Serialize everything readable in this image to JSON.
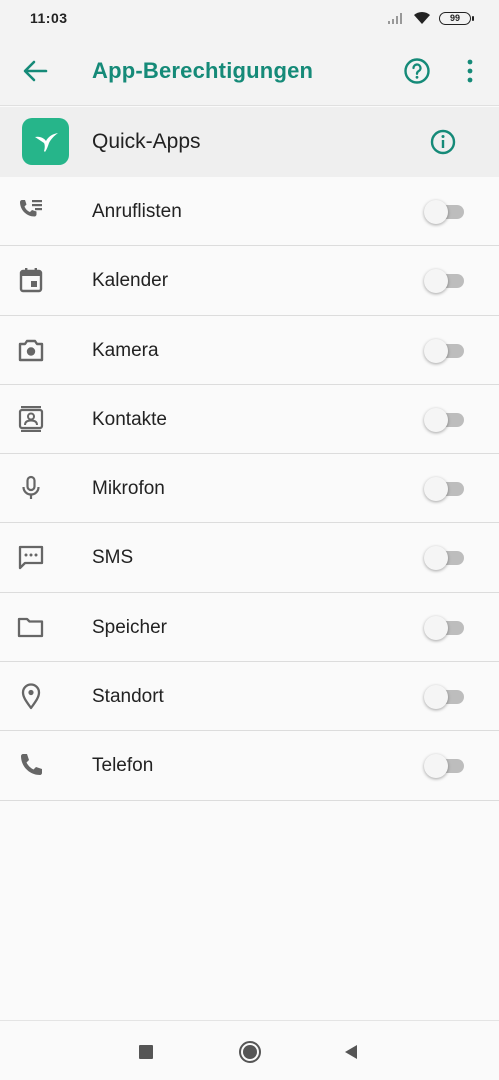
{
  "status_bar": {
    "time": "11:03",
    "battery": "99"
  },
  "toolbar": {
    "title": "App-Berechtigungen",
    "back_icon": "arrow-left-icon",
    "help_icon": "help-circle-icon",
    "more_icon": "more-vert-icon"
  },
  "app": {
    "name": "Quick-Apps",
    "icon": "hummingbird-icon",
    "info_icon": "info-icon"
  },
  "permissions": [
    {
      "label": "Anruflisten",
      "icon": "call-log-icon",
      "enabled": false
    },
    {
      "label": "Kalender",
      "icon": "calendar-icon",
      "enabled": false
    },
    {
      "label": "Kamera",
      "icon": "camera-icon",
      "enabled": false
    },
    {
      "label": "Kontakte",
      "icon": "contacts-icon",
      "enabled": false
    },
    {
      "label": "Mikrofon",
      "icon": "microphone-icon",
      "enabled": false
    },
    {
      "label": "SMS",
      "icon": "sms-icon",
      "enabled": false
    },
    {
      "label": "Speicher",
      "icon": "folder-icon",
      "enabled": false
    },
    {
      "label": "Standort",
      "icon": "location-pin-icon",
      "enabled": false
    },
    {
      "label": "Telefon",
      "icon": "phone-icon",
      "enabled": false
    }
  ],
  "colors": {
    "accent": "#158a78",
    "app_icon_bg": "#26b58a",
    "icon_gray": "#666666"
  }
}
